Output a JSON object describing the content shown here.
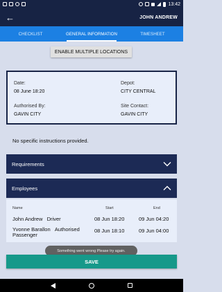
{
  "status_bar": {
    "time": "13:42"
  },
  "app_bar": {
    "title": "JOHN ANDREW"
  },
  "tabs": [
    {
      "label": "CHECKLIST",
      "active": false
    },
    {
      "label": "GENERAL INFORMATION",
      "active": true
    },
    {
      "label": "TIMESHEET",
      "active": false
    }
  ],
  "multi_locations_label": "ENABLE MULTIPLE LOCATIONS",
  "info": {
    "date_label": "Date:",
    "date_value": "08 June 18:20",
    "depot_label": "Depot:",
    "depot_value": "CITY CENTRAL",
    "authorised_label": "Authorised By:",
    "authorised_value": "GAVIN CITY",
    "contact_label": "Site Contact:",
    "contact_value": "GAVIN CITY"
  },
  "instructions": "No specific instructions provided.",
  "sections": {
    "requirements": "Requirements",
    "employees": "Employees"
  },
  "employees": {
    "headers": {
      "name": "Name",
      "start": "Start",
      "end": "End"
    },
    "rows": [
      {
        "name": "John Andrew",
        "role": "Driver",
        "start": "08 Jun 18:20",
        "end": "09 Jun 04:20"
      },
      {
        "name": "Yvonne Barallon",
        "role": "Authorised Passenger",
        "start": "08 Jun 18:10",
        "end": "09 Jun 04:00"
      }
    ]
  },
  "toast": "Something went wrong Please try again.",
  "save_label": "SAVE",
  "colors": {
    "header": "#172344",
    "tabs": "#1c80e3",
    "section": "#1c2a55",
    "save": "#16998a",
    "background": "#d7ddec"
  }
}
